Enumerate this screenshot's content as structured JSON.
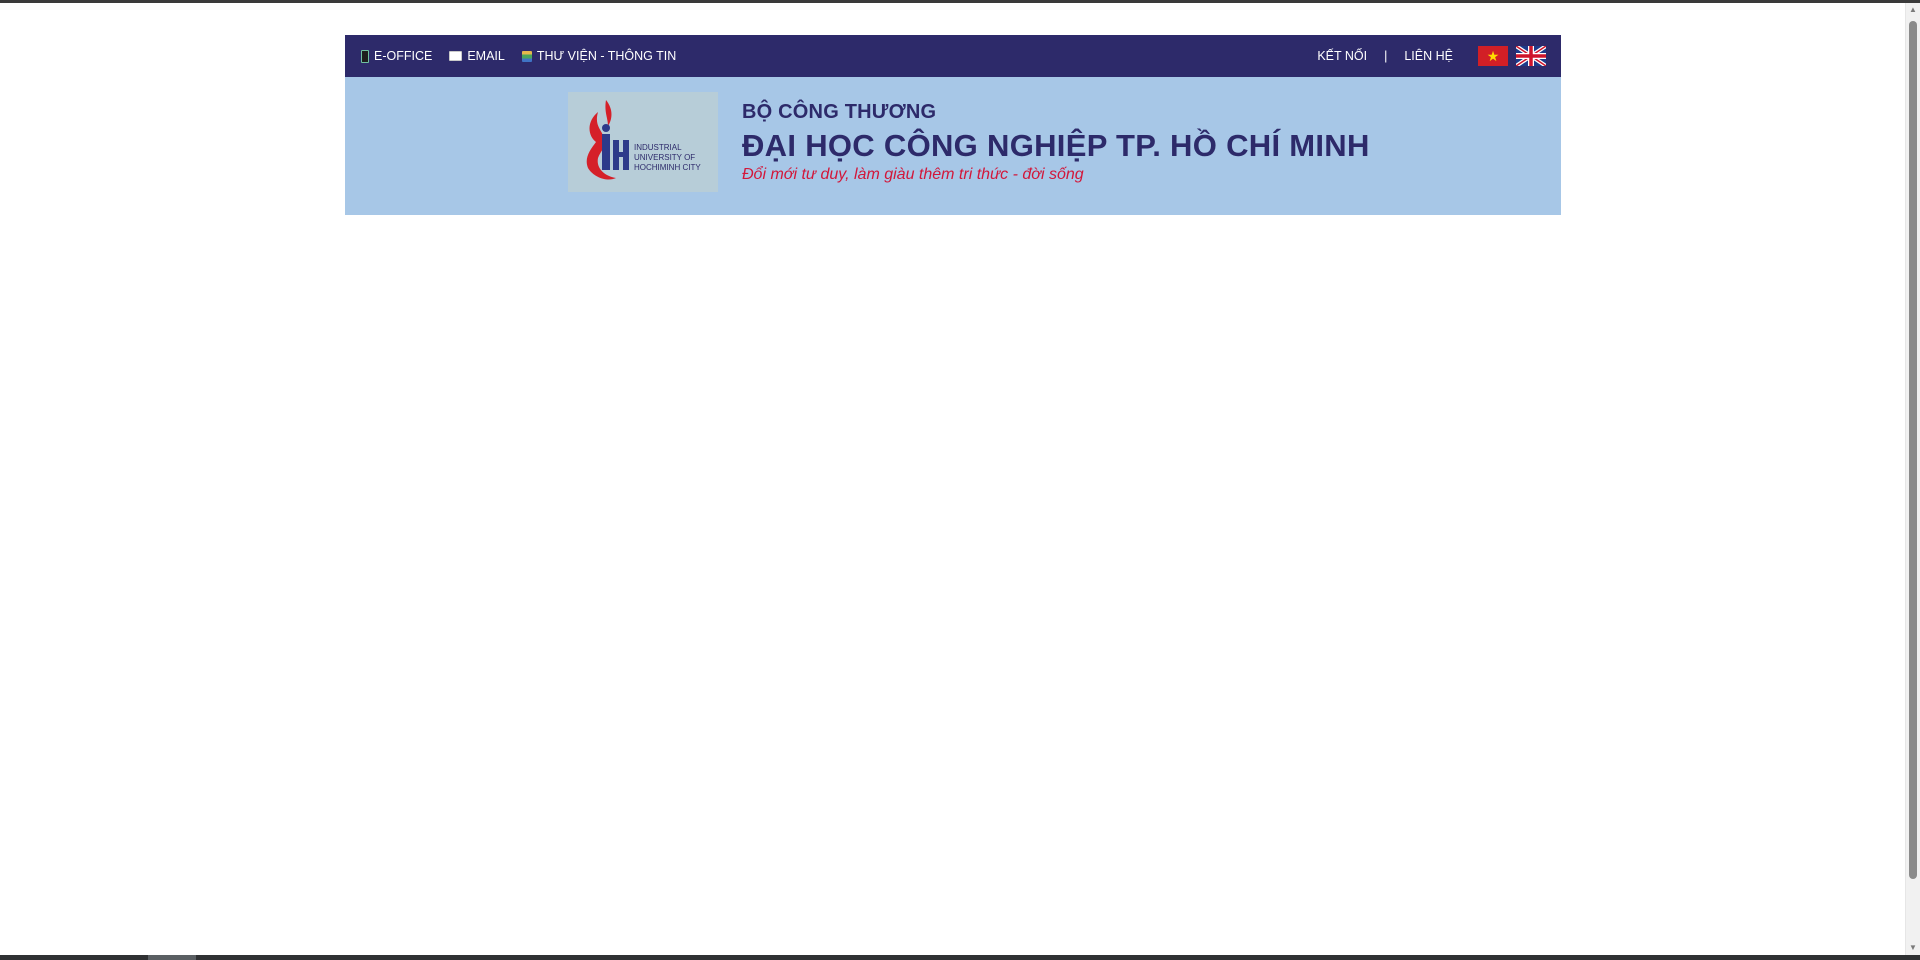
{
  "topbar": {
    "links": [
      {
        "label": "E-OFFICE",
        "icon": "phone-icon"
      },
      {
        "label": "EMAIL",
        "icon": "mail-icon"
      },
      {
        "label": "THƯ VIỆN - THÔNG TIN",
        "icon": "books-icon"
      }
    ],
    "right_links": [
      {
        "label": "KẾT NỐI"
      },
      {
        "label": "LIÊN HỆ"
      }
    ],
    "separator": "|",
    "flags": [
      {
        "name": "vietnam-flag-icon",
        "symbol": "★"
      },
      {
        "name": "uk-flag-icon"
      }
    ]
  },
  "banner": {
    "logo_text": [
      "INDUSTRIAL",
      "UNIVERSITY OF",
      "HOCHIMINH CITY"
    ],
    "ministry": "BỘ CÔNG THƯƠNG",
    "university": "ĐẠI HỌC CÔNG NGHIỆP TP. HỒ CHÍ MINH",
    "slogan": "Đổi mới tư duy, làm giàu thêm tri thức - đời sống"
  },
  "colors": {
    "navy": "#2d2a6a",
    "banner_bg": "#a7c7e7",
    "slogan_red": "#d2173a"
  }
}
